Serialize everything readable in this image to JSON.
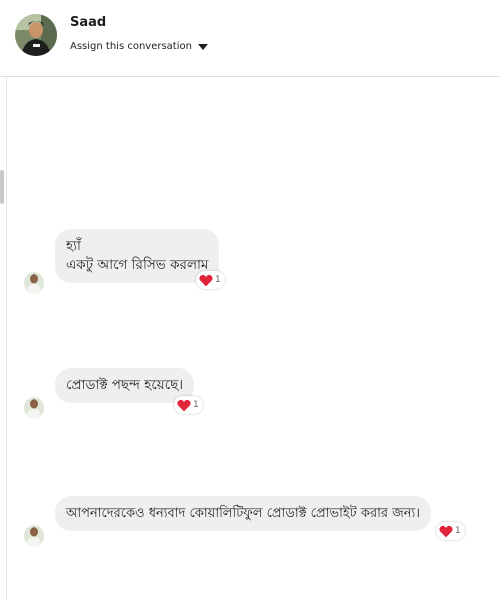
{
  "header": {
    "contact_name": "Saad",
    "assign_label": "Assign this conversation"
  },
  "messages": [
    {
      "lines": [
        "হ্যাঁ",
        "একটু আগে রিসিভ করলাম"
      ],
      "reaction": {
        "icon": "heart-icon",
        "count": "1"
      }
    },
    {
      "lines": [
        "প্রোডাক্ট পছন্দ হয়েছে।"
      ],
      "reaction": {
        "icon": "heart-icon",
        "count": "1"
      }
    },
    {
      "lines": [
        "আপনাদেরকেও ধন্যবাদ কোয়ালিটিফুল প্রোডাক্ট প্রোভাইট করার জন্য।"
      ],
      "reaction": {
        "icon": "heart-icon",
        "count": "1"
      }
    }
  ],
  "colors": {
    "bubble": "#efefef",
    "heart": "#e0243a",
    "divider": "#dddfe2"
  }
}
